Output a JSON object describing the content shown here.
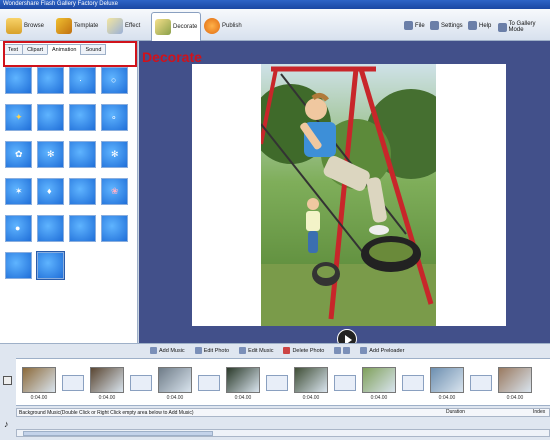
{
  "window": {
    "title": "Wondershare Flash Gallery Factory Deluxe"
  },
  "toolbar": {
    "browse": "Browse",
    "template": "Template",
    "effect": "Effect",
    "decorate": "Decorate",
    "publish": "Publish",
    "file": "File",
    "settings": "Settings",
    "help": "Help",
    "gallery": "To Gallery Mode"
  },
  "tabs": [
    "Text",
    "Clipart",
    "Animation",
    "Sound"
  ],
  "active_tab": "Animation",
  "annotation": "Decorate",
  "bottom_toolbar": {
    "add_music": "Add Music",
    "edit_photo": "Edit Photo",
    "edit_music": "Edit Music",
    "delete_photo": "Delete Photo",
    "add_preloader": "Add Preloader"
  },
  "clips": [
    {
      "dur": "0:04.00",
      "color": "#8c6a3a"
    },
    {
      "dur": "0:04.00",
      "color": "#5a4632"
    },
    {
      "dur": "0:04.00",
      "color": "#6f7c88"
    },
    {
      "dur": "0:04.00",
      "color": "#2b3a2a"
    },
    {
      "dur": "0:04.00",
      "color": "#3f4e36"
    },
    {
      "dur": "0:04.00",
      "color": "#7fa05a"
    },
    {
      "dur": "0:04.00",
      "color": "#6d8fb0"
    },
    {
      "dur": "0:04.00",
      "color": "#9a7a60"
    }
  ],
  "music": {
    "label": "Background Music(Double Click or Right Click empty area below to Add Music)",
    "duration": "Duration",
    "index": "Index"
  },
  "colors": {
    "accent": "#d0121b",
    "stage": "#42508a",
    "thumb": "#1f6ed8"
  }
}
